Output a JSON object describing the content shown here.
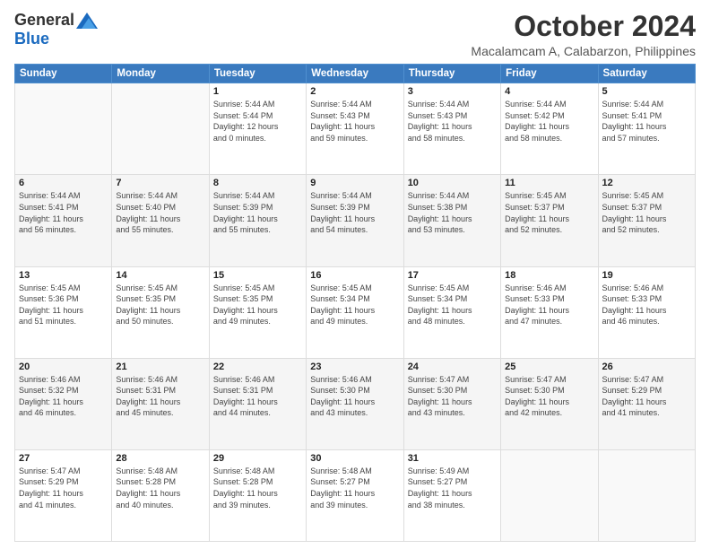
{
  "header": {
    "logo_general": "General",
    "logo_blue": "Blue",
    "month": "October 2024",
    "location": "Macalamcam A, Calabarzon, Philippines"
  },
  "weekdays": [
    "Sunday",
    "Monday",
    "Tuesday",
    "Wednesday",
    "Thursday",
    "Friday",
    "Saturday"
  ],
  "weeks": [
    [
      {
        "day": "",
        "detail": ""
      },
      {
        "day": "",
        "detail": ""
      },
      {
        "day": "1",
        "detail": "Sunrise: 5:44 AM\nSunset: 5:44 PM\nDaylight: 12 hours\nand 0 minutes."
      },
      {
        "day": "2",
        "detail": "Sunrise: 5:44 AM\nSunset: 5:43 PM\nDaylight: 11 hours\nand 59 minutes."
      },
      {
        "day": "3",
        "detail": "Sunrise: 5:44 AM\nSunset: 5:43 PM\nDaylight: 11 hours\nand 58 minutes."
      },
      {
        "day": "4",
        "detail": "Sunrise: 5:44 AM\nSunset: 5:42 PM\nDaylight: 11 hours\nand 58 minutes."
      },
      {
        "day": "5",
        "detail": "Sunrise: 5:44 AM\nSunset: 5:41 PM\nDaylight: 11 hours\nand 57 minutes."
      }
    ],
    [
      {
        "day": "6",
        "detail": "Sunrise: 5:44 AM\nSunset: 5:41 PM\nDaylight: 11 hours\nand 56 minutes."
      },
      {
        "day": "7",
        "detail": "Sunrise: 5:44 AM\nSunset: 5:40 PM\nDaylight: 11 hours\nand 55 minutes."
      },
      {
        "day": "8",
        "detail": "Sunrise: 5:44 AM\nSunset: 5:39 PM\nDaylight: 11 hours\nand 55 minutes."
      },
      {
        "day": "9",
        "detail": "Sunrise: 5:44 AM\nSunset: 5:39 PM\nDaylight: 11 hours\nand 54 minutes."
      },
      {
        "day": "10",
        "detail": "Sunrise: 5:44 AM\nSunset: 5:38 PM\nDaylight: 11 hours\nand 53 minutes."
      },
      {
        "day": "11",
        "detail": "Sunrise: 5:45 AM\nSunset: 5:37 PM\nDaylight: 11 hours\nand 52 minutes."
      },
      {
        "day": "12",
        "detail": "Sunrise: 5:45 AM\nSunset: 5:37 PM\nDaylight: 11 hours\nand 52 minutes."
      }
    ],
    [
      {
        "day": "13",
        "detail": "Sunrise: 5:45 AM\nSunset: 5:36 PM\nDaylight: 11 hours\nand 51 minutes."
      },
      {
        "day": "14",
        "detail": "Sunrise: 5:45 AM\nSunset: 5:35 PM\nDaylight: 11 hours\nand 50 minutes."
      },
      {
        "day": "15",
        "detail": "Sunrise: 5:45 AM\nSunset: 5:35 PM\nDaylight: 11 hours\nand 49 minutes."
      },
      {
        "day": "16",
        "detail": "Sunrise: 5:45 AM\nSunset: 5:34 PM\nDaylight: 11 hours\nand 49 minutes."
      },
      {
        "day": "17",
        "detail": "Sunrise: 5:45 AM\nSunset: 5:34 PM\nDaylight: 11 hours\nand 48 minutes."
      },
      {
        "day": "18",
        "detail": "Sunrise: 5:46 AM\nSunset: 5:33 PM\nDaylight: 11 hours\nand 47 minutes."
      },
      {
        "day": "19",
        "detail": "Sunrise: 5:46 AM\nSunset: 5:33 PM\nDaylight: 11 hours\nand 46 minutes."
      }
    ],
    [
      {
        "day": "20",
        "detail": "Sunrise: 5:46 AM\nSunset: 5:32 PM\nDaylight: 11 hours\nand 46 minutes."
      },
      {
        "day": "21",
        "detail": "Sunrise: 5:46 AM\nSunset: 5:31 PM\nDaylight: 11 hours\nand 45 minutes."
      },
      {
        "day": "22",
        "detail": "Sunrise: 5:46 AM\nSunset: 5:31 PM\nDaylight: 11 hours\nand 44 minutes."
      },
      {
        "day": "23",
        "detail": "Sunrise: 5:46 AM\nSunset: 5:30 PM\nDaylight: 11 hours\nand 43 minutes."
      },
      {
        "day": "24",
        "detail": "Sunrise: 5:47 AM\nSunset: 5:30 PM\nDaylight: 11 hours\nand 43 minutes."
      },
      {
        "day": "25",
        "detail": "Sunrise: 5:47 AM\nSunset: 5:30 PM\nDaylight: 11 hours\nand 42 minutes."
      },
      {
        "day": "26",
        "detail": "Sunrise: 5:47 AM\nSunset: 5:29 PM\nDaylight: 11 hours\nand 41 minutes."
      }
    ],
    [
      {
        "day": "27",
        "detail": "Sunrise: 5:47 AM\nSunset: 5:29 PM\nDaylight: 11 hours\nand 41 minutes."
      },
      {
        "day": "28",
        "detail": "Sunrise: 5:48 AM\nSunset: 5:28 PM\nDaylight: 11 hours\nand 40 minutes."
      },
      {
        "day": "29",
        "detail": "Sunrise: 5:48 AM\nSunset: 5:28 PM\nDaylight: 11 hours\nand 39 minutes."
      },
      {
        "day": "30",
        "detail": "Sunrise: 5:48 AM\nSunset: 5:27 PM\nDaylight: 11 hours\nand 39 minutes."
      },
      {
        "day": "31",
        "detail": "Sunrise: 5:49 AM\nSunset: 5:27 PM\nDaylight: 11 hours\nand 38 minutes."
      },
      {
        "day": "",
        "detail": ""
      },
      {
        "day": "",
        "detail": ""
      }
    ]
  ]
}
